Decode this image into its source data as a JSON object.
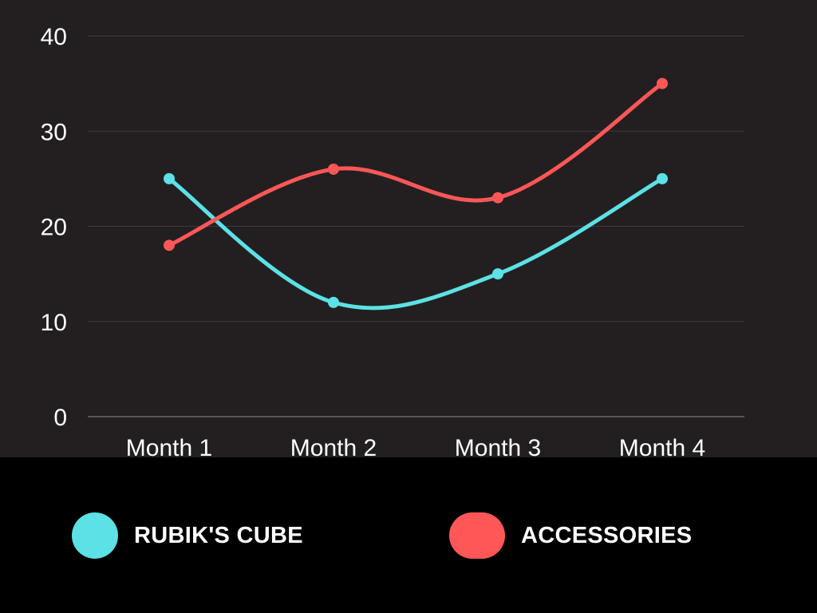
{
  "chart_data": {
    "type": "line",
    "categories": [
      "Month 1",
      "Month 2",
      "Month 3",
      "Month 4"
    ],
    "series": [
      {
        "name": "RUBIK'S CUBE",
        "values": [
          25,
          12,
          15,
          25
        ],
        "color": "#5ce1e6"
      },
      {
        "name": "ACCESSORIES",
        "values": [
          18,
          26,
          23,
          35
        ],
        "color": "#ff5757"
      }
    ],
    "y_ticks": [
      "0",
      "10",
      "20",
      "30",
      "40"
    ],
    "ylim": [
      0,
      40
    ],
    "grid": true,
    "smooth": true,
    "legend_position": "bottom",
    "title": "",
    "xlabel": "",
    "ylabel": ""
  },
  "colors": {
    "chart_background": "#231f20",
    "page_background": "#000000",
    "gridline": "#3d3a3b",
    "text": "#ffffff"
  }
}
